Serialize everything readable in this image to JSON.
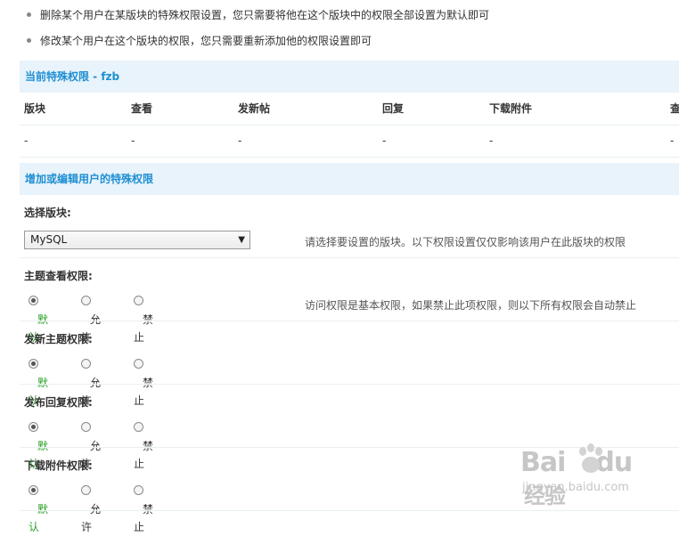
{
  "tips": [
    "删除某个用户在某版块的特殊权限设置，您只需要将他在这个版块中的权限全部设置为默认即可",
    "修改某个用户在这个版块的权限，您只需要重新添加他的权限设置即可"
  ],
  "current": {
    "title": "当前特殊权限 - fzb",
    "columns": [
      "版块",
      "查看",
      "发新帖",
      "回复",
      "下载附件",
      "查"
    ],
    "row": [
      "-",
      "-",
      "-",
      "-",
      "-",
      "-"
    ]
  },
  "edit": {
    "title": "增加或编辑用户的特殊权限",
    "forum_label": "选择版块:",
    "forum_value": "MySQL",
    "forum_hint": "请选择要设置的版块。以下权限设置仅仅影响该用户在此版块的权限",
    "option_labels": [
      "默认",
      "允许",
      "禁止"
    ],
    "permissions": [
      {
        "label": "主题查看权限:",
        "selected": 0,
        "hint": "访问权限是基本权限，如果禁止此项权限，则以下所有权限会自动禁止"
      },
      {
        "label": "发新主题权限:",
        "selected": 0,
        "hint": ""
      },
      {
        "label": "发布回复权限:",
        "selected": 0,
        "hint": ""
      },
      {
        "label": "下载附件权限:",
        "selected": 0,
        "hint": ""
      }
    ]
  },
  "watermark": {
    "logo": "Bai",
    "logo_suffix": "经验",
    "sub": "jingyan.baidu.com"
  },
  "colors": {
    "accent": "#1e8fd2",
    "bar_bg": "#e8f3fb",
    "selected_text": "#2aa12a"
  }
}
